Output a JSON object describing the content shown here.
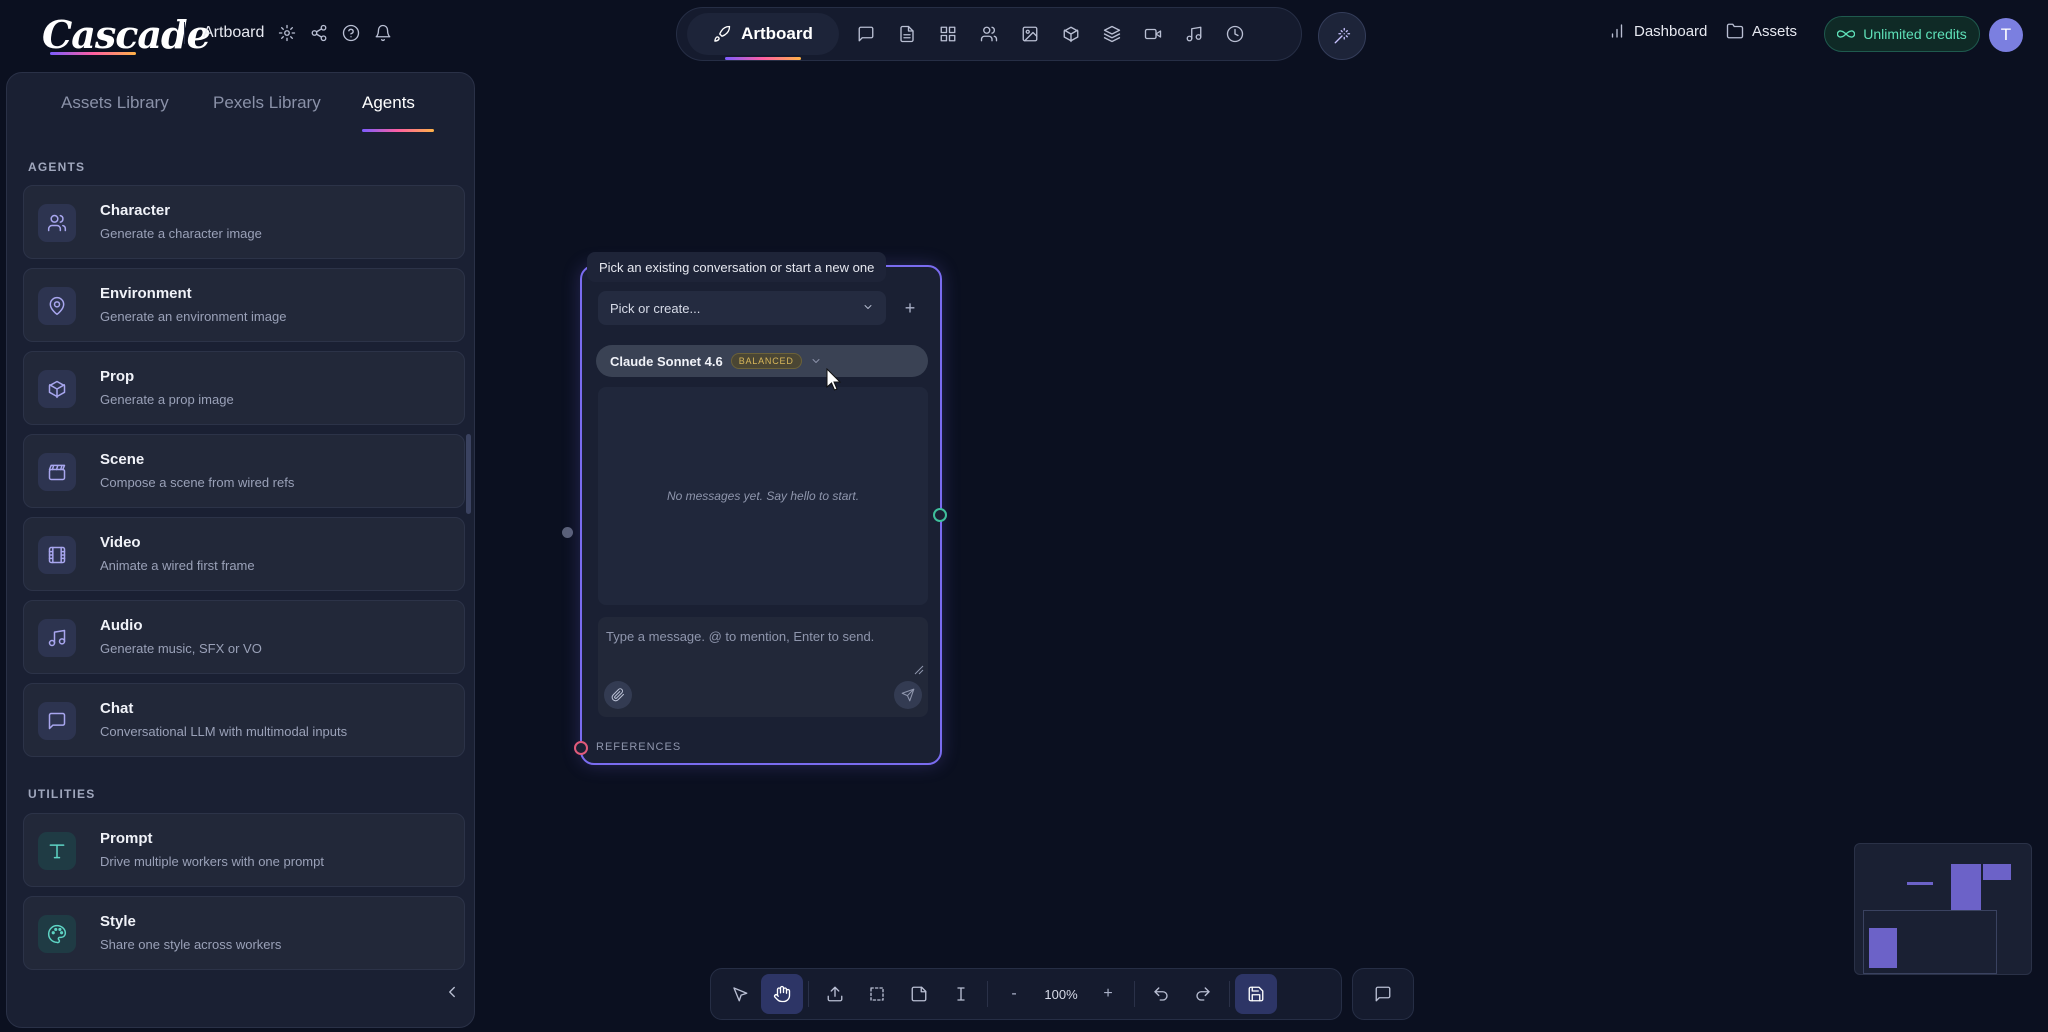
{
  "app": {
    "logo": "Cascade",
    "project_name": "Artboard"
  },
  "topbar": {
    "mode_label": "Artboard",
    "dashboard_label": "Dashboard",
    "assets_label": "Assets",
    "credits_label": "Unlimited credits",
    "avatar_initial": "T"
  },
  "sidebar": {
    "tabs": [
      "Assets Library",
      "Pexels Library",
      "Agents"
    ],
    "active_tab": "Agents",
    "agents_heading": "AGENTS",
    "utilities_heading": "UTILITIES",
    "agents": [
      {
        "title": "Character",
        "desc": "Generate a character image",
        "icon": "users-icon"
      },
      {
        "title": "Environment",
        "desc": "Generate an environment image",
        "icon": "map-pin-icon"
      },
      {
        "title": "Prop",
        "desc": "Generate a prop image",
        "icon": "cube-icon"
      },
      {
        "title": "Scene",
        "desc": "Compose a scene from wired refs",
        "icon": "clapperboard-icon"
      },
      {
        "title": "Video",
        "desc": "Animate a wired first frame",
        "icon": "film-icon"
      },
      {
        "title": "Audio",
        "desc": "Generate music, SFX or VO",
        "icon": "music-icon"
      },
      {
        "title": "Chat",
        "desc": "Conversational LLM with multimodal inputs",
        "icon": "chat-icon"
      }
    ],
    "utilities": [
      {
        "title": "Prompt",
        "desc": "Drive multiple workers with one prompt",
        "icon": "text-icon"
      },
      {
        "title": "Style",
        "desc": "Share one style across workers",
        "icon": "palette-icon"
      }
    ]
  },
  "chat_node": {
    "tooltip": "Pick an existing conversation or start a new one",
    "picker_placeholder": "Pick or create...",
    "plus_label": "+",
    "model_name": "Claude Sonnet 4.6",
    "model_badge": "BALANCED",
    "empty_text": "No messages yet. Say hello to start.",
    "input_placeholder": "Type a message. @ to mention, Enter to send.",
    "references_label": "REFERENCES"
  },
  "bottom_toolbar": {
    "zoom": "100%",
    "zoom_out": "-",
    "zoom_in": "+"
  },
  "colors": {
    "accent": "#7a6cf0",
    "credits": "#5ee0b8",
    "background": "#0b1020"
  }
}
